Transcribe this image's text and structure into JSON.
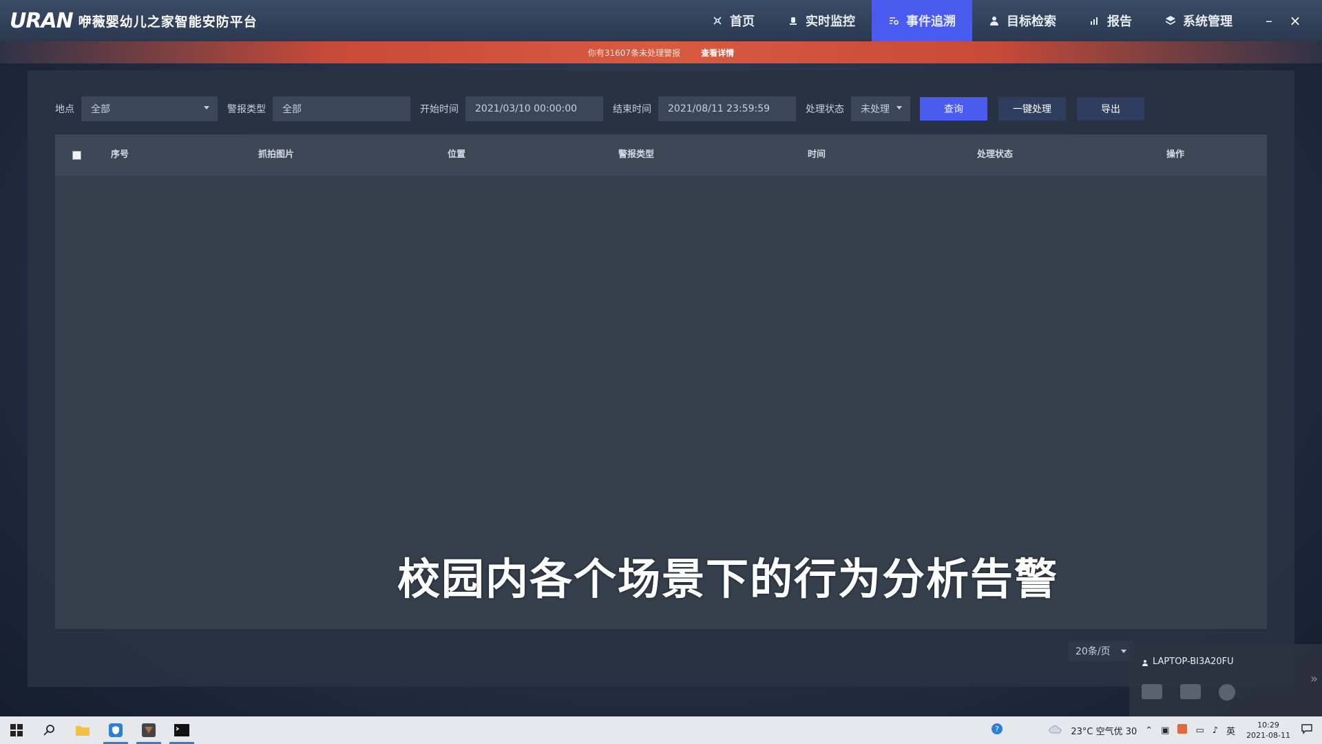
{
  "app": {
    "logo": "URAN",
    "title": "咿薇婴幼儿之家智能安防平台"
  },
  "nav": [
    {
      "label": "首页",
      "icon": "home-icon",
      "active": false
    },
    {
      "label": "实时监控",
      "icon": "camera-icon",
      "active": false
    },
    {
      "label": "事件追溯",
      "icon": "event-icon",
      "active": true
    },
    {
      "label": "目标检索",
      "icon": "person-icon",
      "active": false
    },
    {
      "label": "报告",
      "icon": "report-icon",
      "active": false
    },
    {
      "label": "系统管理",
      "icon": "layers-icon",
      "active": false
    }
  ],
  "window": {
    "minimize": "–",
    "close": "×"
  },
  "alert": {
    "text": "你有31607条未处理警报",
    "link": "查看详情"
  },
  "filters": {
    "location_label": "地点",
    "location_value": "全部",
    "alarm_type_label": "警报类型",
    "alarm_type_value": "全部",
    "start_label": "开始时间",
    "start_value": "2021/03/10 00:00:00",
    "end_label": "结束时间",
    "end_value": "2021/08/11 23:59:59",
    "status_label": "处理状态",
    "status_value": "未处理",
    "query_button": "查询",
    "batch_button": "一键处理",
    "export_button": "导出"
  },
  "table": {
    "columns": [
      "序号",
      "抓拍图片",
      "位置",
      "警报类型",
      "时间",
      "处理状态",
      "操作"
    ],
    "rows": []
  },
  "subtitle": "校园内各个场景下的行为分析告警",
  "pagination": {
    "page_size": "20条/页"
  },
  "remote": {
    "host": "LAPTOP-BI3A20FU"
  },
  "taskbar": {
    "weather": "23°C 空气优 30",
    "ime": "英",
    "time": "10:29",
    "date": "2021-08-11"
  },
  "colors": {
    "accent": "#4a5cf0",
    "alert": "#d85a40",
    "panel": "#36404d"
  }
}
